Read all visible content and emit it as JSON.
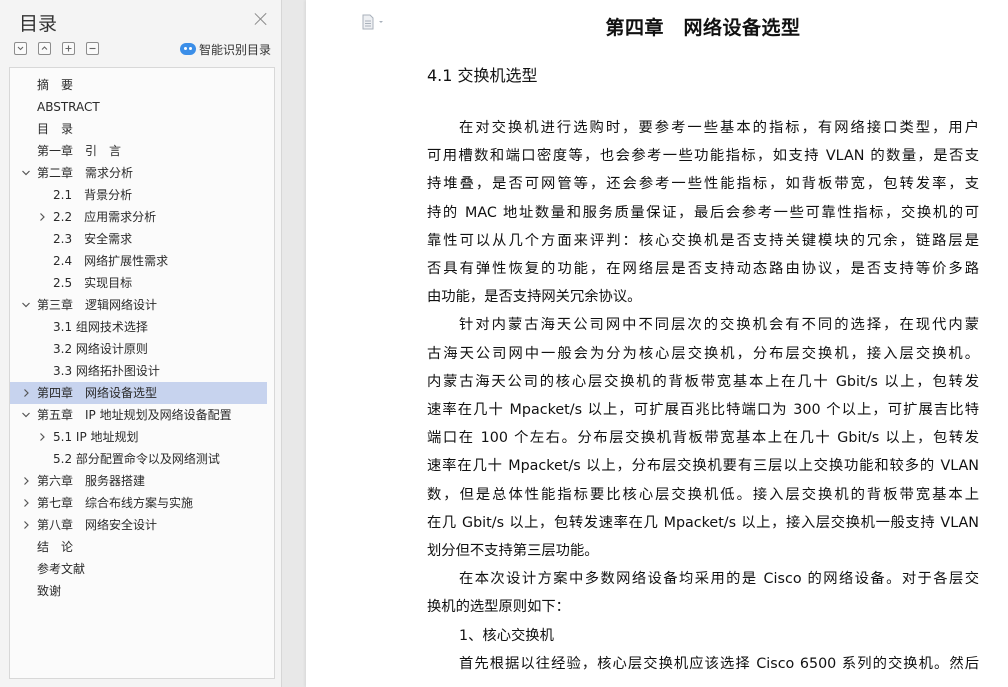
{
  "toc": {
    "title": "目录",
    "smart_label": "智能识别目录",
    "items": [
      {
        "label": "摘　要",
        "level": 0,
        "expander": "none"
      },
      {
        "label": "ABSTRACT",
        "level": 0,
        "expander": "none"
      },
      {
        "label": "目　录",
        "level": 0,
        "expander": "none"
      },
      {
        "label": "第一章　引　言",
        "level": 0,
        "expander": "none"
      },
      {
        "label": "第二章　需求分析",
        "level": 0,
        "expander": "down"
      },
      {
        "label": "2.1　背景分析",
        "level": 1,
        "expander": "none"
      },
      {
        "label": "2.2　应用需求分析",
        "level": 1,
        "expander": "right"
      },
      {
        "label": "2.3　安全需求",
        "level": 1,
        "expander": "none"
      },
      {
        "label": "2.4　网络扩展性需求",
        "level": 1,
        "expander": "none"
      },
      {
        "label": "2.5　实现目标",
        "level": 1,
        "expander": "none"
      },
      {
        "label": "第三章　逻辑网络设计",
        "level": 0,
        "expander": "down"
      },
      {
        "label": "3.1 组网技术选择",
        "level": 1,
        "expander": "none"
      },
      {
        "label": "3.2 网络设计原则",
        "level": 1,
        "expander": "none"
      },
      {
        "label": "3.3 网络拓扑图设计",
        "level": 1,
        "expander": "none"
      },
      {
        "label": "第四章　网络设备选型",
        "level": 0,
        "expander": "right",
        "selected": true
      },
      {
        "label": "第五章　IP 地址规划及网络设备配置",
        "level": 0,
        "expander": "down"
      },
      {
        "label": "5.1 IP 地址规划",
        "level": 1,
        "expander": "right"
      },
      {
        "label": "5.2 部分配置命令以及网络测试",
        "level": 1,
        "expander": "none"
      },
      {
        "label": "第六章　服务器搭建",
        "level": 0,
        "expander": "right"
      },
      {
        "label": "第七章　综合布线方案与实施",
        "level": 0,
        "expander": "right"
      },
      {
        "label": "第八章　网络安全设计",
        "level": 0,
        "expander": "right"
      },
      {
        "label": "结　论",
        "level": 0,
        "expander": "none"
      },
      {
        "label": "参考文献",
        "level": 0,
        "expander": "none"
      },
      {
        "label": "致谢",
        "level": 0,
        "expander": "none"
      }
    ]
  },
  "document": {
    "chapter_title": "第四章　网络设备选型",
    "section_title": "4.1  交换机选型",
    "lines": [
      {
        "text": "在对交换机进行选购时，要参考一些基本的指标，有网络接口类型，用户",
        "type": "first"
      },
      {
        "text": "可用槽数和端口密度等，也会参考一些功能指标，如支持 VLAN 的数量，是否支",
        "type": "body"
      },
      {
        "text": "持堆叠，是否可网管等，还会参考一些性能指标，如背板带宽，包转发率，支",
        "type": "body"
      },
      {
        "text": "持的 MAC 地址数量和服务质量保证，最后会参考一些可靠性指标，交换机的可",
        "type": "body"
      },
      {
        "text": "靠性可以从几个方面来评判：核心交换机是否支持关键模块的冗余，链路层是",
        "type": "body"
      },
      {
        "text": "否具有弹性恢复的功能，在网络层是否支持动态路由协议，是否支持等价多路",
        "type": "body"
      },
      {
        "text": "由功能，是否支持网关冗余协议。",
        "type": "last"
      },
      {
        "text": "针对内蒙古海天公司网中不同层次的交换机会有不同的选择，在现代内蒙",
        "type": "first"
      },
      {
        "text": "古海天公司网中一般会为分为核心层交换机，分布层交换机，接入层交换机。",
        "type": "body"
      },
      {
        "text": "内蒙古海天公司的核心层交换机的背板带宽基本上在几十 Gbit/s 以上，包转发",
        "type": "body"
      },
      {
        "text": "速率在几十 Mpacket/s 以上，可扩展百兆比特端口为 300 个以上，可扩展吉比特",
        "type": "body"
      },
      {
        "text": "端口在 100 个左右。分布层交换机背板带宽基本上在几十 Gbit/s 以上，包转发",
        "type": "body"
      },
      {
        "text": "速率在几十 Mpacket/s 以上，分布层交换机要有三层以上交换功能和较多的 VLAN",
        "type": "body"
      },
      {
        "text": "数，但是总体性能指标要比核心层交换机低。接入层交换机的背板带宽基本上",
        "type": "body"
      },
      {
        "text": "在几 Gbit/s 以上，包转发速率在几 Mpacket/s 以上，接入层交换机一般支持 VLAN",
        "type": "body"
      },
      {
        "text": "划分但不支持第三层功能。",
        "type": "last"
      },
      {
        "text": "在本次设计方案中多数网络设备均采用的是 Cisco 的网络设备。对于各层交",
        "type": "first"
      },
      {
        "text": "换机的选型原则如下：",
        "type": "last"
      },
      {
        "text": "1、核心交换机",
        "type": "first-short"
      },
      {
        "text": "首先根据以往经验，核心层交换机应该选择 Cisco 6500 系列的交换机。然后",
        "type": "first"
      }
    ]
  }
}
